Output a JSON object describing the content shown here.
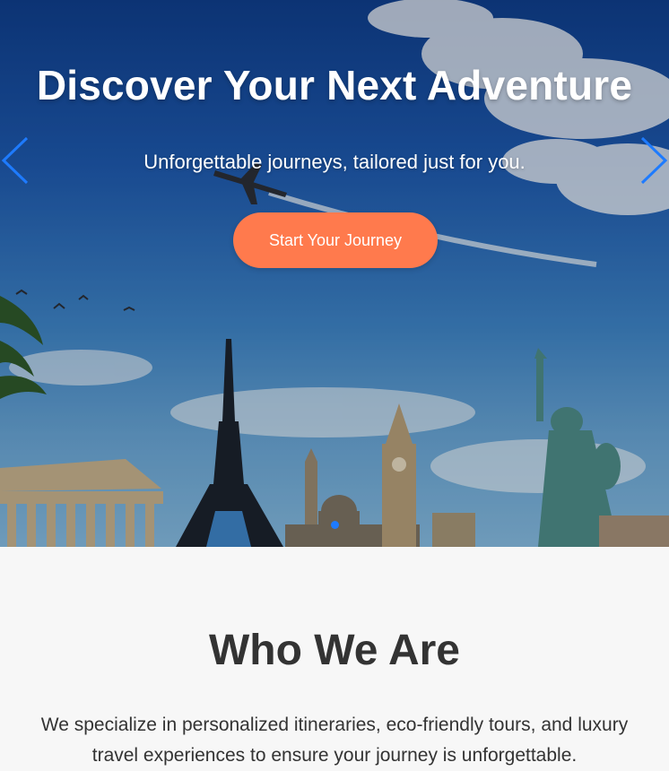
{
  "hero": {
    "title": "Discover Your Next Adventure",
    "subtitle": "Unforgettable journeys, tailored just for you.",
    "cta_label": "Start Your Journey",
    "prev_icon": "chevron-left-icon",
    "next_icon": "chevron-right-icon",
    "active_slide": 1
  },
  "about": {
    "title": "Who We Are",
    "text": "We specialize in personalized itineraries, eco-friendly tours, and luxury travel experiences to ensure your journey is unforgettable."
  },
  "colors": {
    "accent": "#ff7a4d",
    "arrow": "#1e7bff",
    "text_dark": "#333333",
    "section_bg": "#f7f7f7"
  }
}
